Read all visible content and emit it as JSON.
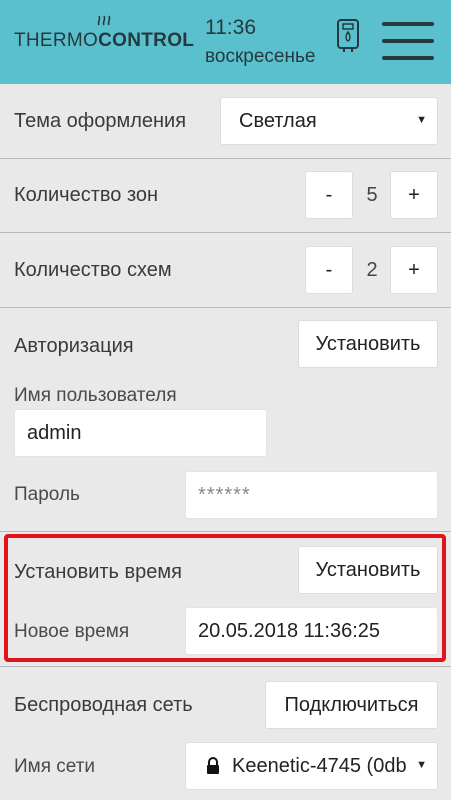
{
  "header": {
    "logo_thin": "THERMO",
    "logo_bold": "CONTROL",
    "time": "11:36",
    "day": "воскресенье"
  },
  "settings": {
    "theme": {
      "label": "Тема оформления",
      "value": "Светлая"
    },
    "zones": {
      "label": "Количество зон",
      "minus": "-",
      "value": "5",
      "plus": "+"
    },
    "schemes": {
      "label": "Количество схем",
      "minus": "-",
      "value": "2",
      "plus": "+"
    },
    "auth": {
      "label": "Авторизация",
      "button": "Установить",
      "username_label": "Имя пользователя",
      "username_value": "admin",
      "password_label": "Пароль",
      "password_placeholder": "******"
    },
    "set_time": {
      "label": "Установить время",
      "button": "Установить",
      "new_time_label": "Новое время",
      "new_time_value": "20.05.2018 11:36:25"
    },
    "wifi": {
      "label": "Беспроводная сеть",
      "button": "Подключиться",
      "ssid_label": "Имя сети",
      "ssid_value": "Keenetic-4745 (0db"
    }
  },
  "colors": {
    "header_bg": "#5bc0ce",
    "page_bg": "#e9e9e9",
    "highlight": "#e2121b"
  }
}
